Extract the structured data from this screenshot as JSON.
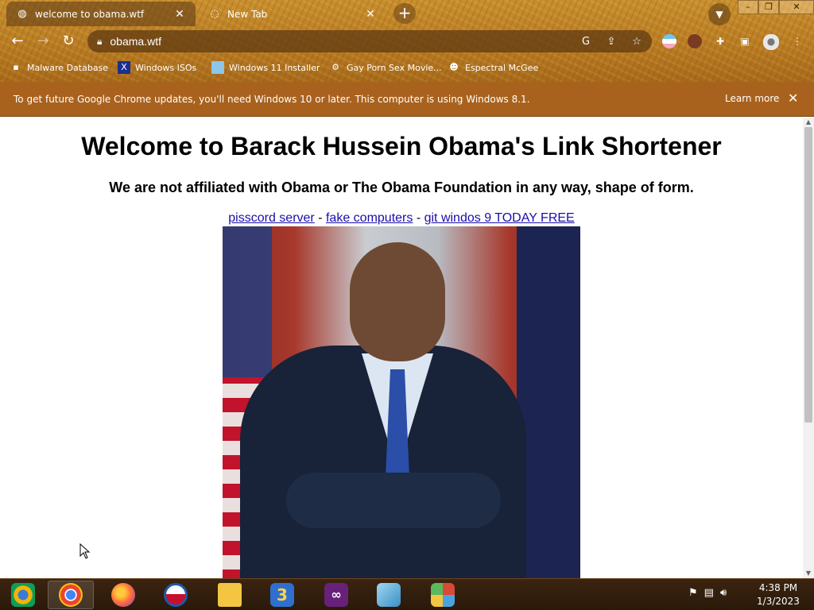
{
  "browser": {
    "tabs": [
      {
        "title": "welcome to obama.wtf",
        "active": true
      },
      {
        "title": "New Tab",
        "active": false
      }
    ],
    "new_tab": "+",
    "url": "obama.wtf",
    "bookmarks": [
      {
        "label": "Malware Database",
        "icon": "bug-icon"
      },
      {
        "label": "Windows ISOs",
        "icon": "x-icon"
      },
      {
        "label": "Windows 11 Installer",
        "icon": "image-icon"
      },
      {
        "label": "Gay Porn Sex Movie...",
        "icon": "site-icon"
      },
      {
        "label": "Espectral McGee",
        "icon": "avatar-icon"
      }
    ]
  },
  "infobar": {
    "message": "To get future Google Chrome updates, you'll need Windows 10 or later. This computer is using Windows 8.1.",
    "learn_more": "Learn more"
  },
  "page": {
    "heading": "Welcome to Barack Hussein Obama's Link Shortener",
    "subheading": "We are not affiliated with Obama or The Obama Foundation in any way, shape of form.",
    "links": [
      {
        "label": "pisscord server"
      },
      {
        "label": "fake computers"
      },
      {
        "label": "git windos 9 TODAY FREE"
      }
    ],
    "separator": " - "
  },
  "taskbar": {
    "apps": [
      {
        "name": "Chrome Canary"
      },
      {
        "name": "Google Chrome",
        "active": true
      },
      {
        "name": "Firefox"
      },
      {
        "name": "Obama App"
      },
      {
        "name": "File Explorer"
      },
      {
        "name": "App 3"
      },
      {
        "name": "Visual Studio"
      },
      {
        "name": "Notepad"
      },
      {
        "name": "Windows Tiles"
      }
    ],
    "time": "4:38 PM",
    "date": "1/3/2023"
  },
  "colors": {
    "infobar": "#a9621e",
    "link": "#1a0dab",
    "chrome_theme": "#b87a22"
  }
}
